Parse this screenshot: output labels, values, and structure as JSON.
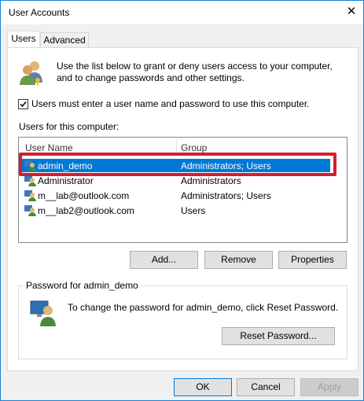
{
  "window": {
    "title": "User Accounts"
  },
  "tabs": [
    {
      "label": "Users",
      "active": true
    },
    {
      "label": "Advanced",
      "active": false
    }
  ],
  "intro_text_1": "Use the list below to grant or deny users access to your computer,",
  "intro_text_2": "and to change passwords and other settings.",
  "checkbox_label": "Users must enter a user name and password to use this computer.",
  "checkbox_checked": true,
  "users_label": "Users for this computer:",
  "list": {
    "columns": [
      "User Name",
      "Group"
    ],
    "rows": [
      {
        "name": "admin_demo",
        "group": "Administrators; Users",
        "selected": true
      },
      {
        "name": "Administrator",
        "group": "Administrators",
        "selected": false
      },
      {
        "name": "m__lab@outlook.com",
        "group": "Administrators; Users",
        "selected": false
      },
      {
        "name": "m__lab2@outlook.com",
        "group": "Users",
        "selected": false
      }
    ]
  },
  "buttons": {
    "add": "Add...",
    "remove": "Remove",
    "properties": "Properties"
  },
  "password_group": {
    "title": "Password for admin_demo",
    "text": "To change the password for admin_demo, click Reset Password.",
    "reset_button": "Reset Password..."
  },
  "footer": {
    "ok": "OK",
    "cancel": "Cancel",
    "apply": "Apply"
  },
  "colors": {
    "selection": "#0078d7",
    "highlight_box": "#d81b2c",
    "accent_border": "#1883d7"
  }
}
